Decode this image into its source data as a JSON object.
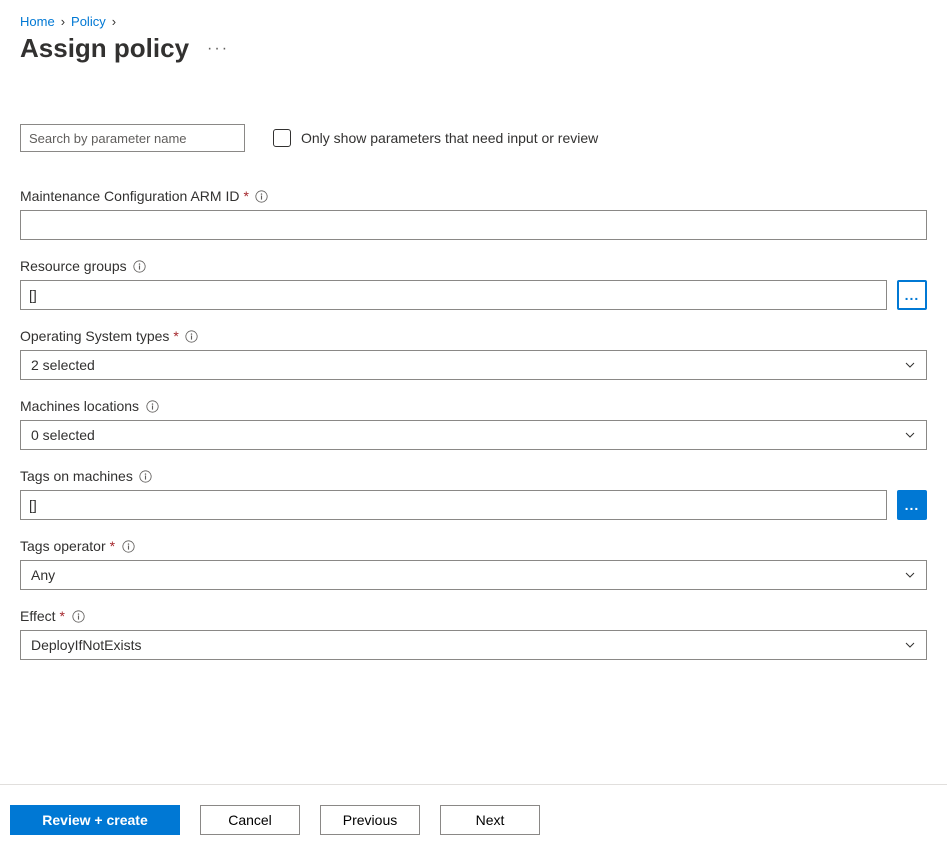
{
  "breadcrumb": {
    "home": "Home",
    "policy": "Policy"
  },
  "title": "Assign policy",
  "search": {
    "placeholder": "Search by parameter name"
  },
  "filter_checkbox": {
    "label": "Only show parameters that need input or review"
  },
  "fields": {
    "maintenance": {
      "label": "Maintenance Configuration ARM ID",
      "required": true,
      "value": ""
    },
    "resource_groups": {
      "label": "Resource groups",
      "required": false,
      "value": "[]"
    },
    "os_types": {
      "label": "Operating System types",
      "required": true,
      "value": "2 selected"
    },
    "locations": {
      "label": "Machines locations",
      "required": false,
      "value": "0 selected"
    },
    "tags_machines": {
      "label": "Tags on machines",
      "required": false,
      "value": "[]"
    },
    "tags_operator": {
      "label": "Tags operator",
      "required": true,
      "value": "Any"
    },
    "effect": {
      "label": "Effect",
      "required": true,
      "value": "DeployIfNotExists"
    }
  },
  "footer": {
    "review": "Review + create",
    "cancel": "Cancel",
    "previous": "Previous",
    "next": "Next"
  }
}
